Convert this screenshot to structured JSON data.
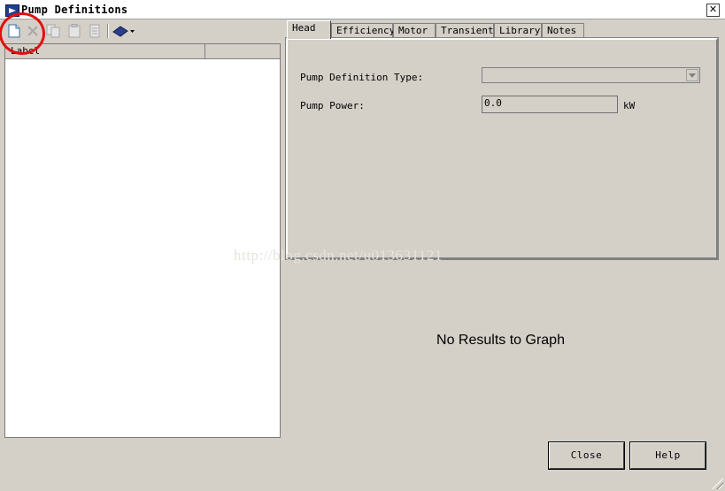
{
  "window": {
    "title": "Pump Definitions",
    "close_glyph": "✕"
  },
  "toolbar": {
    "buttons": [
      {
        "name": "new-document-icon",
        "enabled": true
      },
      {
        "name": "delete-x-icon",
        "enabled": false
      },
      {
        "name": "copy-icon",
        "enabled": false
      },
      {
        "name": "paste-icon",
        "enabled": false
      },
      {
        "name": "properties-icon",
        "enabled": false
      },
      {
        "name": "book-dropdown-icon",
        "enabled": true
      }
    ]
  },
  "list": {
    "columns": [
      "Label",
      ""
    ]
  },
  "tabs": [
    "Head",
    "Efficiency",
    "Motor",
    "Transient",
    "Library",
    "Notes"
  ],
  "active_tab": "Head",
  "form": {
    "definition_type_label": "Pump Definition Type:",
    "definition_type_value": "",
    "power_label": "Pump Power:",
    "power_value": "0.0",
    "power_unit": "kW"
  },
  "graph": {
    "message": "No Results to Graph"
  },
  "watermark": "http://blog.csdn.net/u013631121",
  "buttons": {
    "close": "Close",
    "help": "Help"
  },
  "colors": {
    "annotation_circle": "#e01010",
    "face": "#d4d0c8"
  }
}
